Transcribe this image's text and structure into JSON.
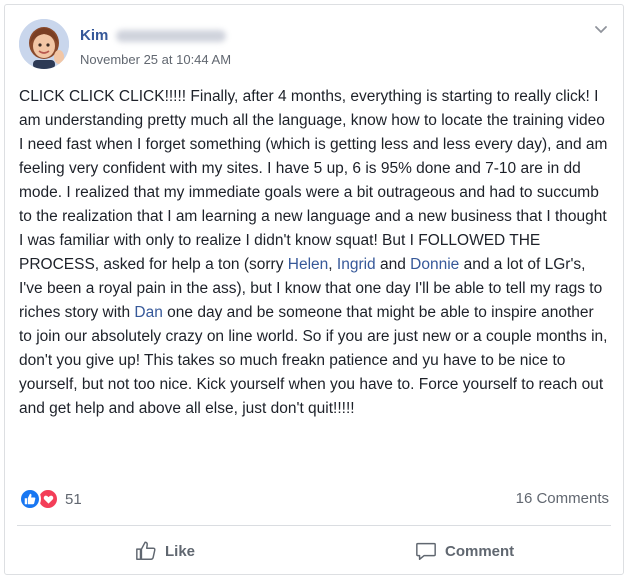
{
  "post": {
    "author": "Kim",
    "timestamp": "November 25 at 10:44 AM",
    "body": {
      "p1": "CLICK CLICK CLICK!!!!! Finally, after 4 months, everything is starting to really click! I am understanding pretty much all the language, know how to locate the training video I need fast when I forget something (which is getting less and less every day), and am feeling very confident with my sites. I have 5 up, 6 is 95% done and 7-10 are in dd mode. I realized that my immediate goals were a bit outrageous and had to succumb to the realization that I am learning a new language and a new business that I thought I was familiar with only to realize I didn't know squat! But I FOLLOWED THE PROCESS, asked for help a ton (sorry ",
      "mention1": "Helen",
      "sep1": ", ",
      "mention2": "Ingrid",
      "sep2": " and ",
      "mention3": "Donnie",
      "p2": " and a lot of LGr's, I've been a royal pain in the ass), but I know that one day I'll be able to tell my rags to riches story with ",
      "mention4": "Dan",
      "p3": " one day and be someone that might be able to inspire another to join our absolutely crazy on line world. So if you are just new or a couple months in, don't you give up! This takes so much freakn patience and yu have to be nice to yourself, but not too nice. Kick yourself when you have to. Force yourself to reach out and get help and above all else, just don't quit!!!!!"
    },
    "reactions": {
      "count": "51",
      "icons": [
        "like-reaction-icon",
        "love-reaction-icon"
      ],
      "like_color": "#1877f2",
      "love_color": "#f33e58"
    },
    "comments_label": "16 Comments"
  },
  "actions": {
    "like_label": "Like",
    "comment_label": "Comment"
  },
  "colors": {
    "link": "#365899",
    "text": "#1d2129",
    "muted": "#616770"
  }
}
